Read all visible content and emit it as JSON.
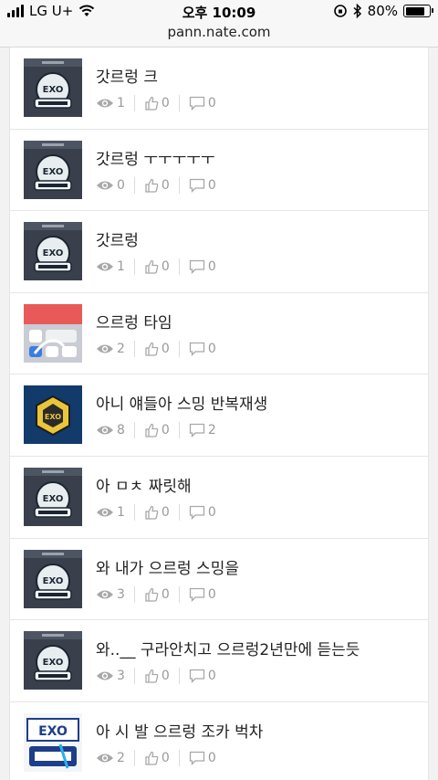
{
  "status_bar": {
    "carrier": "LG U+",
    "time": "오후 10:09",
    "battery": "80%",
    "battery_level": 0.8
  },
  "browser": {
    "url": "pann.nate.com"
  },
  "posts": [
    {
      "title": "갓르렁 크",
      "views": "1",
      "likes": "0",
      "comments": "0",
      "thumb": "exo-phone"
    },
    {
      "title": "갓르렁 ㅜㅜㅜㅜㅜ",
      "views": "0",
      "likes": "0",
      "comments": "0",
      "thumb": "exo-phone"
    },
    {
      "title": "갓르렁",
      "views": "1",
      "likes": "0",
      "comments": "0",
      "thumb": "exo-phone"
    },
    {
      "title": "으르렁 타임",
      "views": "2",
      "likes": "0",
      "comments": "0",
      "thumb": "phone-screen"
    },
    {
      "title": "아니 얘들아 스밍 반복재생",
      "views": "8",
      "likes": "0",
      "comments": "2",
      "thumb": "exo-hexagon"
    },
    {
      "title": "아 ㅁㅊ 짜릿해",
      "views": "1",
      "likes": "0",
      "comments": "0",
      "thumb": "exo-phone"
    },
    {
      "title": "와 내가 으르렁 스밍을",
      "views": "3",
      "likes": "0",
      "comments": "0",
      "thumb": "exo-phone"
    },
    {
      "title": "와..__ 구라안치고 으르렁2년만에 듣는듯",
      "views": "3",
      "likes": "0",
      "comments": "0",
      "thumb": "exo-phone"
    },
    {
      "title": "아 시 발 으르렁 조카 벅차",
      "views": "2",
      "likes": "0",
      "comments": "0",
      "thumb": "exo-logo"
    }
  ]
}
